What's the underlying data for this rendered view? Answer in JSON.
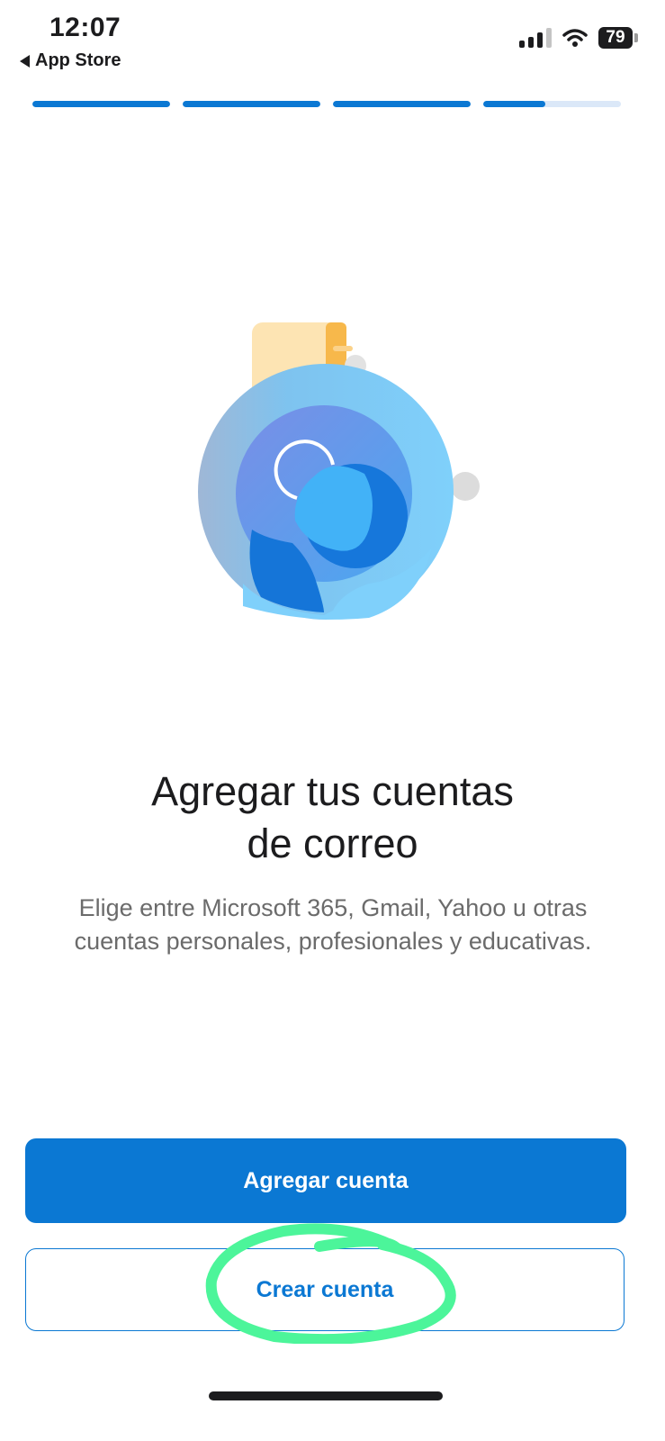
{
  "status_bar": {
    "time": "12:07",
    "back_app": "App Store",
    "battery": "79",
    "icons": [
      "signal-icon",
      "wifi-icon",
      "battery-icon"
    ]
  },
  "onboarding": {
    "progress_steps": [
      1,
      1,
      1,
      0.45
    ],
    "title_line1": "Agregar tus cuentas",
    "title_line2": "de correo",
    "subtitle": "Elige entre Microsoft 365, Gmail, Yahoo u otras cuentas personales, profesionales y educativas."
  },
  "actions": {
    "add_account": "Agregar cuenta",
    "create_account": "Crear cuenta"
  },
  "colors": {
    "accent": "#0b78d3",
    "annotation": "#4cf59a"
  }
}
